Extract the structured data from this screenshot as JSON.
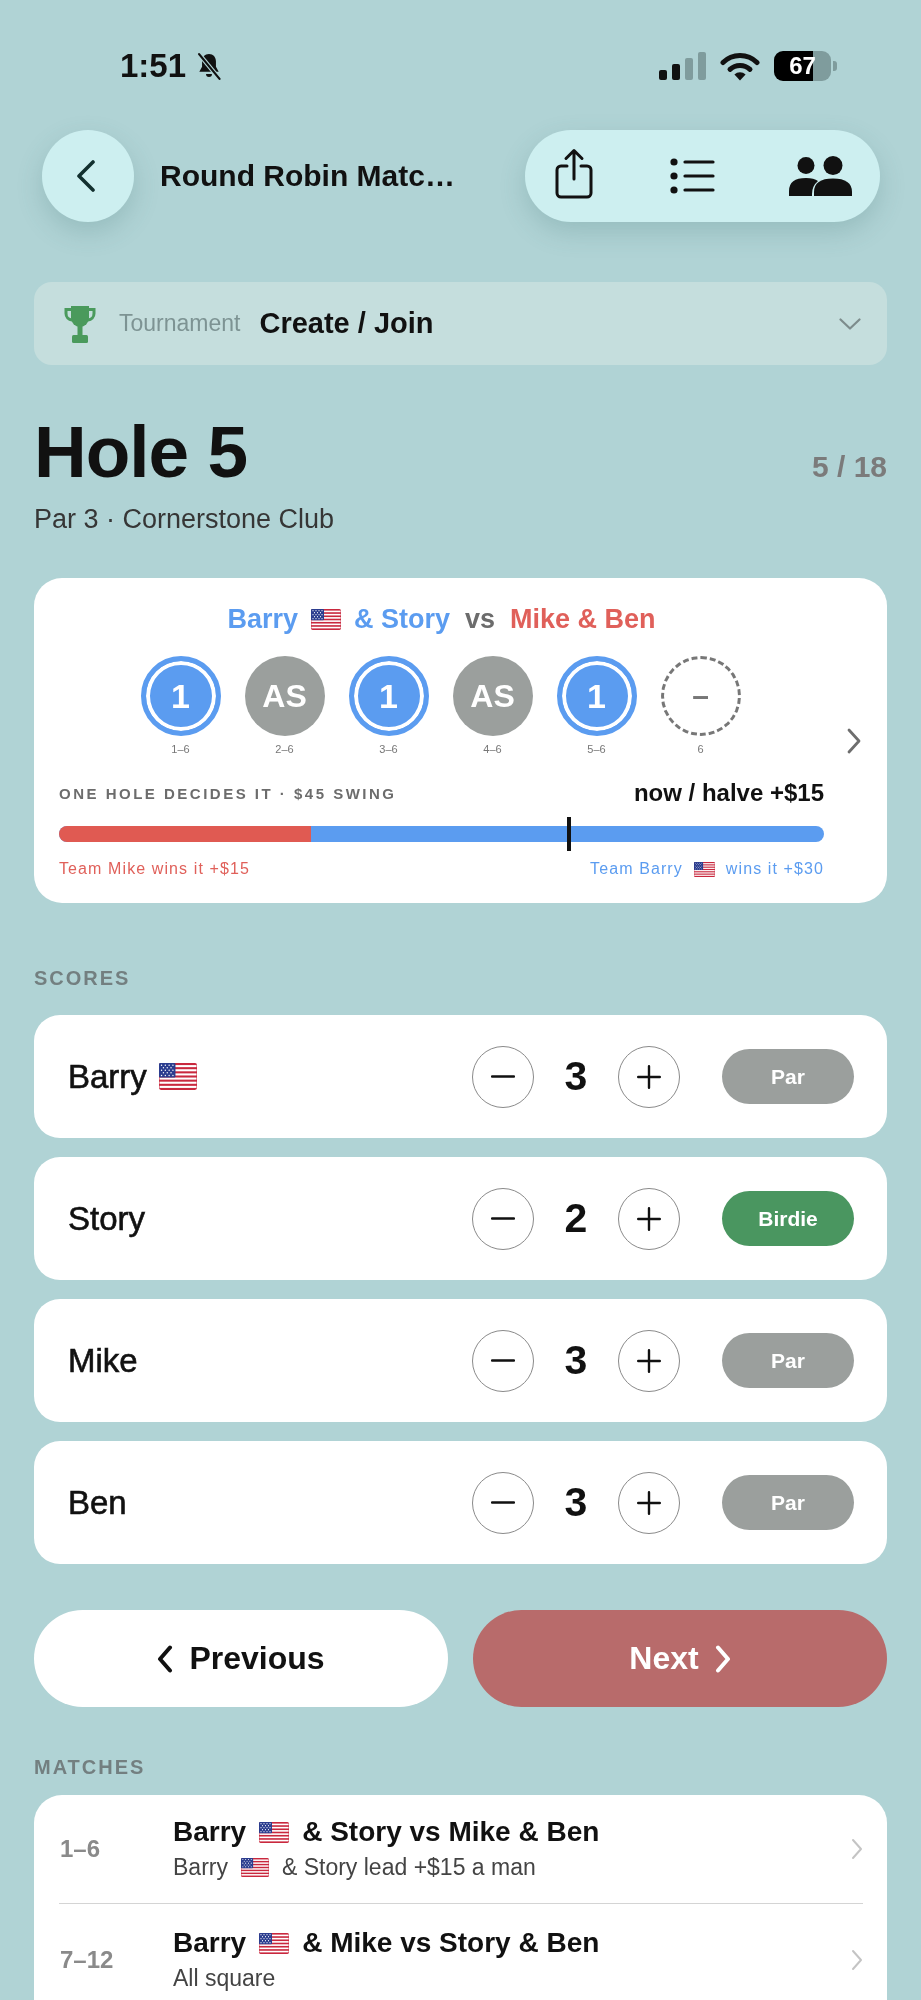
{
  "status_bar": {
    "time": "1:51",
    "battery": "67"
  },
  "header": {
    "title": "Round Robin Matc…"
  },
  "tournament": {
    "label": "Tournament",
    "value": "Create / Join"
  },
  "hole": {
    "title": "Hole 5",
    "count": "5 / 18",
    "details": "Par 3 · Cornerstone Club"
  },
  "match_card": {
    "team_a": [
      {
        "text": "Barry",
        "flag": true
      },
      {
        "text": "& Story",
        "flag": false
      }
    ],
    "versus": "vs",
    "team_b": "Mike & Ben",
    "holes": [
      {
        "result": "1",
        "kind": "won",
        "label": "1–6"
      },
      {
        "result": "AS",
        "kind": "halved",
        "label": "2–6"
      },
      {
        "result": "1",
        "kind": "won",
        "label": "3–6"
      },
      {
        "result": "AS",
        "kind": "halved",
        "label": "4–6"
      },
      {
        "result": "1",
        "kind": "won",
        "label": "5–6"
      },
      {
        "result": "–",
        "kind": "pending",
        "label": "6"
      }
    ],
    "swing_label": "ONE HOLE DECIDES IT · $45 SWING",
    "swing_now": "now / halve +$15",
    "swing_bar": {
      "level": 0.33
    },
    "swing_marker": {
      "level": 0.667
    },
    "left_outcome": [
      {
        "text": "Team Mike wins it +$15",
        "flag": false
      }
    ],
    "right_outcome": [
      {
        "text": "Team Barry",
        "flag": true
      },
      {
        "text": "wins it +$30",
        "flag": false
      }
    ]
  },
  "scores": {
    "heading": "SCORES",
    "players": [
      {
        "name": "Barry",
        "flag": true,
        "score": "3",
        "result": "Par",
        "kind": "par"
      },
      {
        "name": "Story",
        "flag": false,
        "score": "2",
        "result": "Birdie",
        "kind": "birdie"
      },
      {
        "name": "Mike",
        "flag": false,
        "score": "3",
        "result": "Par",
        "kind": "par"
      },
      {
        "name": "Ben",
        "flag": false,
        "score": "3",
        "result": "Par",
        "kind": "par"
      }
    ]
  },
  "nav_buttons": {
    "previous": "Previous",
    "next": "Next"
  },
  "matches": {
    "heading": "MATCHES",
    "items": [
      {
        "holes": "1–6",
        "title": [
          {
            "text": "Barry",
            "flag": true
          },
          {
            "text": "& Story vs Mike & Ben",
            "flag": false
          }
        ],
        "summary": [
          {
            "text": "Barry",
            "flag": true
          },
          {
            "text": "& Story lead +$15 a man",
            "flag": false
          }
        ]
      },
      {
        "holes": "7–12",
        "title": [
          {
            "text": "Barry",
            "flag": true
          },
          {
            "text": "& Mike vs Story & Ben",
            "flag": false
          }
        ],
        "summary": [
          {
            "text": "All square",
            "flag": false
          }
        ]
      }
    ]
  }
}
